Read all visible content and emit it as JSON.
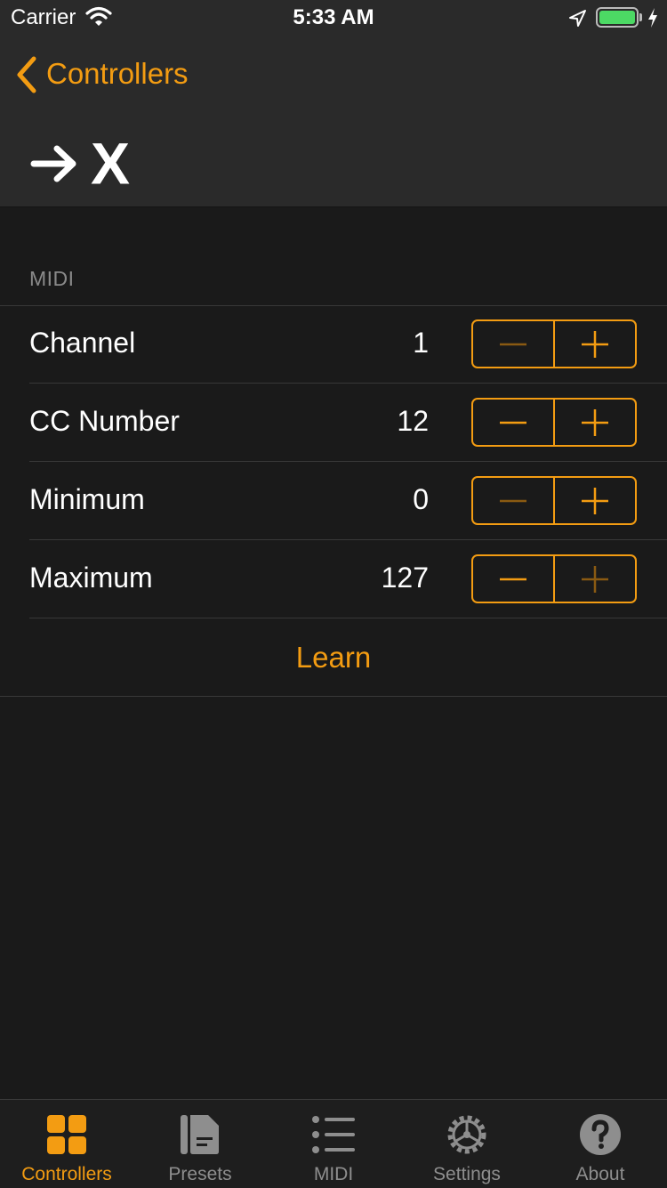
{
  "status_bar": {
    "carrier": "Carrier",
    "time": "5:33 AM"
  },
  "nav": {
    "back_label": "Controllers",
    "title": "X"
  },
  "section": {
    "header": "MIDI"
  },
  "rows": [
    {
      "label": "Channel",
      "value": "1"
    },
    {
      "label": "CC Number",
      "value": "12"
    },
    {
      "label": "Minimum",
      "value": "0"
    },
    {
      "label": "Maximum",
      "value": "127"
    }
  ],
  "learn_label": "Learn",
  "tabs": [
    {
      "label": "Controllers",
      "icon": "grid-icon",
      "active": true
    },
    {
      "label": "Presets",
      "icon": "document-icon",
      "active": false
    },
    {
      "label": "MIDI",
      "icon": "list-icon",
      "active": false
    },
    {
      "label": "Settings",
      "icon": "gear-icon",
      "active": false
    },
    {
      "label": "About",
      "icon": "question-icon",
      "active": false
    }
  ],
  "colors": {
    "accent": "#f39c12",
    "accent_dim": "#8a5a12",
    "background": "#1a1a1a",
    "nav_background": "#2a2a2a",
    "inactive_tab": "#8e8e8e"
  }
}
